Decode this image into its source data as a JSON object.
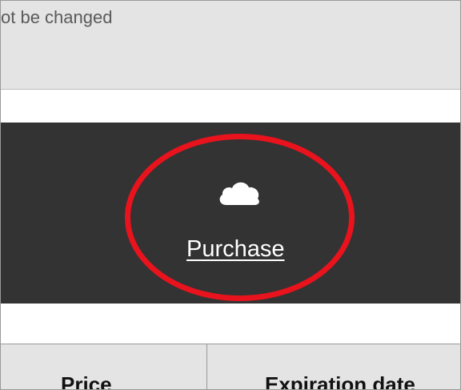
{
  "top": {
    "note": "ot be changed"
  },
  "purchase": {
    "label": "Purchase",
    "icon": "cloud-icon"
  },
  "table": {
    "columns": [
      "Price",
      "Expiration date"
    ]
  },
  "colors": {
    "highlight": "#e8131d",
    "band": "#333333",
    "panel": "#e4e4e4"
  }
}
